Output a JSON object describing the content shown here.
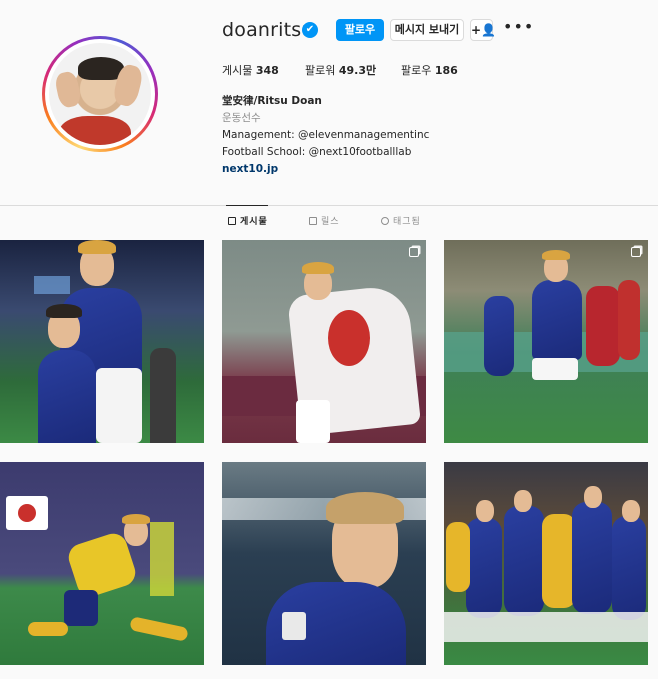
{
  "profile": {
    "username": "doanritsu",
    "verified_mark": "✔",
    "follow_label": "팔로우",
    "message_label": "메시지 보내기",
    "suggest_icon": "+👤",
    "more_icon": "•••"
  },
  "stats": {
    "posts_label": "게시물",
    "posts_value": "348",
    "followers_label": "팔로워",
    "followers_value": "49.3만",
    "following_label": "팔로우",
    "following_value": "186"
  },
  "bio": {
    "name": "堂安律/Ritsu Doan",
    "category": "운동선수",
    "management": "Management: @elevenmanagementinc",
    "school": "Football School: @next10footballlab",
    "link": "next10.jp"
  },
  "tabs": [
    {
      "label": "게시물",
      "icon": "grid-icon",
      "active": true
    },
    {
      "label": "릴스",
      "icon": "reels-icon",
      "active": false
    },
    {
      "label": "태그됨",
      "icon": "tag-icon",
      "active": false
    }
  ],
  "colors": {
    "accent": "#0095f6",
    "text": "#262626",
    "muted": "#8e8e8e",
    "link": "#00376b",
    "jersey": "#2a3fa0"
  },
  "posts": [
    {
      "multiple": false
    },
    {
      "multiple": true
    },
    {
      "multiple": true
    },
    {
      "multiple": false
    },
    {
      "multiple": false
    },
    {
      "multiple": false
    }
  ]
}
